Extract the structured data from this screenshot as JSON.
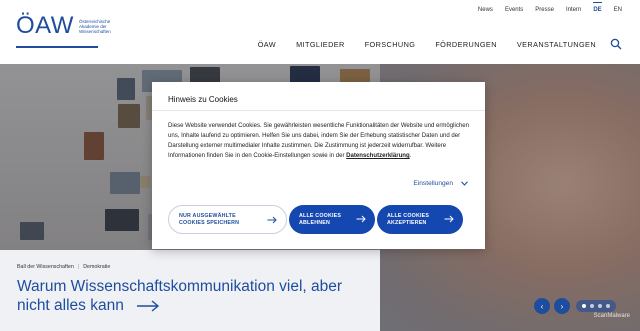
{
  "header": {
    "logo_mark": "ÖAW",
    "logo_lines": [
      "Österreichische",
      "Akademie der",
      "Wissenschaften"
    ],
    "top_links": [
      "News",
      "Events",
      "Presse",
      "Intern"
    ],
    "languages": [
      "DE",
      "EN"
    ],
    "nav": [
      "ÖAW",
      "MITGLIEDER",
      "FORSCHUNG",
      "FÖRDERUNGEN",
      "VERANSTALTUNGEN"
    ]
  },
  "hero": {
    "breadcrumb": [
      "Ball der Wissenschaften",
      "Demokratie"
    ],
    "headline": "Warum Wissenschaftskommunikation viel, aber nicht alles kann",
    "prev_icon": "chevron-left-icon",
    "next_icon": "chevron-right-icon",
    "watermark": "ScanMalware"
  },
  "cookie": {
    "title": "Hinweis zu Cookies",
    "body": "Diese Website verwendet Cookies. Sie gewährleisten wesentliche Funktionalitäten der Website und ermöglichen uns, Inhalte laufend zu optimieren. Helfen Sie uns dabei, indem Sie der Erhebung statistischer Daten und der Darstellung externer multimedialer Inhalte zustimmen. Die Zustimmung ist jederzeit widerrufbar. Weitere Informationen finden Sie in den Cookie-Einstellungen sowie in der ",
    "link": "Datenschutzerklärung",
    "after_link": ".",
    "settings_label": "Einstellungen",
    "btn_selected": "NUR AUSGEWÄHLTE COOKIES SPEICHERN",
    "btn_reject": "ALLE COOKIES ABLEHNEN",
    "btn_accept": "ALLE COOKIES AKZEPTIEREN"
  },
  "colors": {
    "brand": "#1e4d9e",
    "button": "#1547b0"
  }
}
